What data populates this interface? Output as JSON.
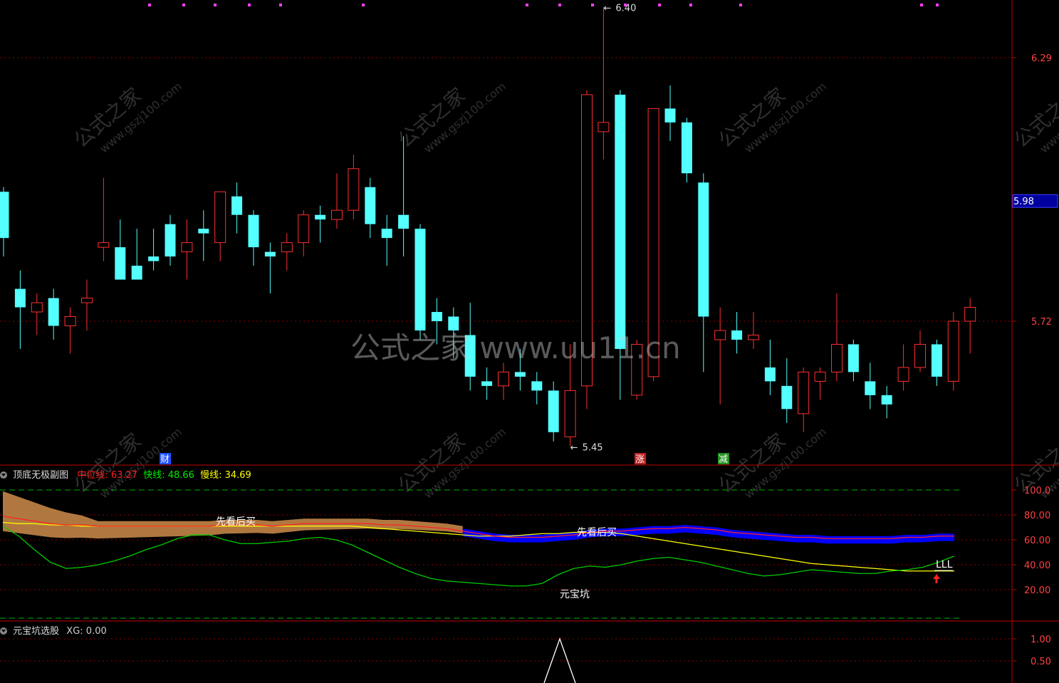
{
  "colors": {
    "up": "#ff3030",
    "down": "#54ffff",
    "grid": "#8b0000",
    "axis": "#c00000",
    "price_box": "#1a1aff",
    "sentiment_fill": "#b07840",
    "bull_fill": "#0000ff",
    "fast_line": "#00cc00",
    "slow_line": "#ffff00",
    "mid_line": "#ff2020"
  },
  "main_panel": {
    "price_label": "5.98",
    "watermark_big": "公式之家 www.uu11.cn",
    "watermark_small": "公式之家",
    "watermark_small_url": "www.gszj100.com",
    "markers": [
      {
        "text": "财",
        "color": "#2050ff"
      },
      {
        "text": "涨",
        "color": "#c02020"
      },
      {
        "text": "减",
        "color": "#209020"
      }
    ],
    "high_label": "6.40",
    "low_label": "5.45"
  },
  "sub_panel": {
    "title": "顶底无极副图",
    "values": [
      {
        "name": "中位线",
        "value": "63.27",
        "color": "#ff2020"
      },
      {
        "name": "快线",
        "value": "48.66",
        "color": "#00ee00"
      },
      {
        "name": "慢线",
        "value": "34.69",
        "color": "#ffff00"
      }
    ],
    "annotations": [
      {
        "text": "先看后买"
      },
      {
        "text": "先看后买"
      },
      {
        "text": "元宝坑"
      },
      {
        "text": "LLL"
      }
    ]
  },
  "xg_panel": {
    "title": "元宝坑选股",
    "values": [
      {
        "name": "XG",
        "value": "0.00",
        "color": "#cccccc"
      }
    ]
  },
  "chart_data": [
    {
      "type": "candlestick",
      "title": "",
      "y_ticks": [
        "6.29",
        "5.98",
        "5.72"
      ],
      "ylim": [
        5.4,
        6.45
      ],
      "annotations": [
        "6.40",
        "5.45"
      ],
      "candles": [
        {
          "o": 6.0,
          "h": 6.01,
          "l": 5.86,
          "c": 5.9
        },
        {
          "o": 5.79,
          "h": 5.83,
          "l": 5.66,
          "c": 5.75
        },
        {
          "o": 5.74,
          "h": 5.78,
          "l": 5.69,
          "c": 5.76
        },
        {
          "o": 5.77,
          "h": 5.79,
          "l": 5.68,
          "c": 5.71
        },
        {
          "o": 5.71,
          "h": 5.75,
          "l": 5.65,
          "c": 5.73
        },
        {
          "o": 5.76,
          "h": 5.81,
          "l": 5.7,
          "c": 5.77
        },
        {
          "o": 5.88,
          "h": 6.03,
          "l": 5.85,
          "c": 5.89
        },
        {
          "o": 5.88,
          "h": 5.94,
          "l": 5.83,
          "c": 5.81
        },
        {
          "o": 5.84,
          "h": 5.92,
          "l": 5.83,
          "c": 5.81
        },
        {
          "o": 5.86,
          "h": 5.92,
          "l": 5.83,
          "c": 5.85
        },
        {
          "o": 5.93,
          "h": 5.95,
          "l": 5.84,
          "c": 5.86
        },
        {
          "o": 5.87,
          "h": 5.94,
          "l": 5.81,
          "c": 5.89
        },
        {
          "o": 5.92,
          "h": 5.96,
          "l": 5.85,
          "c": 5.91
        },
        {
          "o": 5.89,
          "h": 6.0,
          "l": 5.85,
          "c": 6.0
        },
        {
          "o": 5.99,
          "h": 6.02,
          "l": 5.91,
          "c": 5.95
        },
        {
          "o": 5.95,
          "h": 5.96,
          "l": 5.84,
          "c": 5.88
        },
        {
          "o": 5.87,
          "h": 5.89,
          "l": 5.78,
          "c": 5.86
        },
        {
          "o": 5.87,
          "h": 5.91,
          "l": 5.83,
          "c": 5.89
        },
        {
          "o": 5.89,
          "h": 5.96,
          "l": 5.86,
          "c": 5.95
        },
        {
          "o": 5.95,
          "h": 5.97,
          "l": 5.89,
          "c": 5.94
        },
        {
          "o": 5.94,
          "h": 6.04,
          "l": 5.92,
          "c": 5.96
        },
        {
          "o": 5.96,
          "h": 6.08,
          "l": 5.94,
          "c": 6.05
        },
        {
          "o": 6.01,
          "h": 6.03,
          "l": 5.9,
          "c": 5.93
        },
        {
          "o": 5.92,
          "h": 5.95,
          "l": 5.84,
          "c": 5.9
        },
        {
          "o": 5.95,
          "h": 6.12,
          "l": 5.86,
          "c": 5.92
        },
        {
          "o": 5.92,
          "h": 5.93,
          "l": 5.68,
          "c": 5.7
        },
        {
          "o": 5.74,
          "h": 5.77,
          "l": 5.67,
          "c": 5.72
        },
        {
          "o": 5.73,
          "h": 5.75,
          "l": 5.64,
          "c": 5.7
        },
        {
          "o": 5.69,
          "h": 5.76,
          "l": 5.57,
          "c": 5.6
        },
        {
          "o": 5.59,
          "h": 5.62,
          "l": 5.55,
          "c": 5.58
        },
        {
          "o": 5.58,
          "h": 5.63,
          "l": 5.55,
          "c": 5.61
        },
        {
          "o": 5.61,
          "h": 5.66,
          "l": 5.57,
          "c": 5.6
        },
        {
          "o": 5.59,
          "h": 5.61,
          "l": 5.54,
          "c": 5.57
        },
        {
          "o": 5.57,
          "h": 5.59,
          "l": 5.46,
          "c": 5.48
        },
        {
          "o": 5.47,
          "h": 5.67,
          "l": 5.45,
          "c": 5.57
        },
        {
          "o": 5.58,
          "h": 6.22,
          "l": 5.53,
          "c": 6.21
        },
        {
          "o": 6.13,
          "h": 6.4,
          "l": 6.07,
          "c": 6.15
        },
        {
          "o": 6.21,
          "h": 6.22,
          "l": 5.55,
          "c": 5.66
        },
        {
          "o": 5.56,
          "h": 5.68,
          "l": 5.55,
          "c": 5.67
        },
        {
          "o": 5.6,
          "h": 6.18,
          "l": 5.59,
          "c": 6.18
        },
        {
          "o": 6.18,
          "h": 6.23,
          "l": 6.11,
          "c": 6.15
        },
        {
          "o": 6.15,
          "h": 6.16,
          "l": 6.02,
          "c": 6.04
        },
        {
          "o": 6.02,
          "h": 6.04,
          "l": 5.61,
          "c": 5.73
        },
        {
          "o": 5.68,
          "h": 5.75,
          "l": 5.54,
          "c": 5.7
        },
        {
          "o": 5.7,
          "h": 5.74,
          "l": 5.65,
          "c": 5.68
        },
        {
          "o": 5.68,
          "h": 5.74,
          "l": 5.66,
          "c": 5.69
        },
        {
          "o": 5.62,
          "h": 5.68,
          "l": 5.56,
          "c": 5.59
        },
        {
          "o": 5.58,
          "h": 5.64,
          "l": 5.5,
          "c": 5.53
        },
        {
          "o": 5.52,
          "h": 5.62,
          "l": 5.48,
          "c": 5.61
        },
        {
          "o": 5.59,
          "h": 5.62,
          "l": 5.55,
          "c": 5.61
        },
        {
          "o": 5.61,
          "h": 5.78,
          "l": 5.59,
          "c": 5.67
        },
        {
          "o": 5.67,
          "h": 5.68,
          "l": 5.59,
          "c": 5.61
        },
        {
          "o": 5.59,
          "h": 5.63,
          "l": 5.53,
          "c": 5.56
        },
        {
          "o": 5.56,
          "h": 5.58,
          "l": 5.51,
          "c": 5.54
        },
        {
          "o": 5.59,
          "h": 5.67,
          "l": 5.57,
          "c": 5.62
        },
        {
          "o": 5.62,
          "h": 5.7,
          "l": 5.61,
          "c": 5.67
        },
        {
          "o": 5.67,
          "h": 5.68,
          "l": 5.58,
          "c": 5.6
        },
        {
          "o": 5.59,
          "h": 5.74,
          "l": 5.57,
          "c": 5.72
        },
        {
          "o": 5.72,
          "h": 5.77,
          "l": 5.65,
          "c": 5.75
        }
      ]
    },
    {
      "type": "line",
      "title": "顶底无极副图",
      "y_ticks": [
        "100.0",
        "80.00",
        "60.00",
        "40.00",
        "20.00"
      ],
      "ylim": [
        -10,
        110
      ],
      "series": [
        {
          "name": "中位线",
          "values": [
            79,
            77,
            75,
            73,
            72,
            72,
            71,
            71,
            71,
            71,
            71,
            71,
            71,
            71,
            72,
            72,
            72,
            71,
            72,
            73,
            73,
            73,
            73,
            73,
            72,
            72,
            71,
            70,
            69,
            67,
            65,
            63,
            62,
            62,
            62,
            63,
            64,
            66,
            67,
            67,
            68,
            69,
            69,
            70,
            69,
            68,
            66,
            65,
            64,
            63,
            62,
            62,
            61,
            61,
            61,
            61,
            61,
            62,
            62,
            63,
            63
          ]
        },
        {
          "name": "快线",
          "values": [
            71,
            63,
            52,
            42,
            37,
            38,
            40,
            43,
            47,
            52,
            56,
            61,
            64,
            64,
            60,
            57,
            57,
            58,
            59,
            61,
            62,
            60,
            56,
            50,
            44,
            38,
            33,
            29,
            27,
            26,
            25,
            24,
            23,
            23,
            25,
            32,
            37,
            39,
            38,
            40,
            43,
            45,
            46,
            44,
            42,
            39,
            36,
            33,
            31,
            32,
            34,
            36,
            35,
            34,
            33,
            33,
            35,
            36,
            38,
            42,
            47
          ]
        },
        {
          "name": "慢线",
          "values": [
            74,
            73,
            73,
            72,
            72,
            71,
            71,
            71,
            71,
            71,
            71,
            71,
            71,
            71,
            71,
            71,
            71,
            71,
            71,
            71,
            71,
            71,
            71,
            70,
            69,
            68,
            67,
            66,
            65,
            64,
            63,
            63,
            63,
            64,
            65,
            65,
            66,
            66,
            66,
            65,
            63,
            61,
            59,
            57,
            55,
            53,
            51,
            49,
            47,
            45,
            43,
            41,
            40,
            39,
            38,
            37,
            36,
            35,
            35,
            35,
            35
          ]
        }
      ],
      "annotations": [
        "先看后买",
        "先看后买",
        "元宝坑",
        "LLL"
      ]
    },
    {
      "type": "line",
      "title": "元宝坑选股",
      "y_ticks": [
        "1.00",
        "0.50"
      ],
      "ylim": [
        0,
        1.2
      ],
      "series": [
        {
          "name": "XG",
          "values": [
            0,
            0,
            0,
            0,
            0,
            0,
            0,
            0,
            0,
            0,
            0,
            0,
            0,
            0,
            0,
            0,
            0,
            0,
            0,
            0,
            0,
            0,
            0,
            0,
            0,
            0,
            0,
            0,
            0,
            0,
            0,
            0,
            0,
            1,
            0,
            0,
            0,
            0,
            0,
            0,
            0,
            0,
            0,
            0,
            0,
            0,
            0,
            0,
            0,
            0,
            0,
            0,
            0,
            0,
            0,
            0,
            0,
            0,
            0
          ]
        }
      ]
    }
  ]
}
